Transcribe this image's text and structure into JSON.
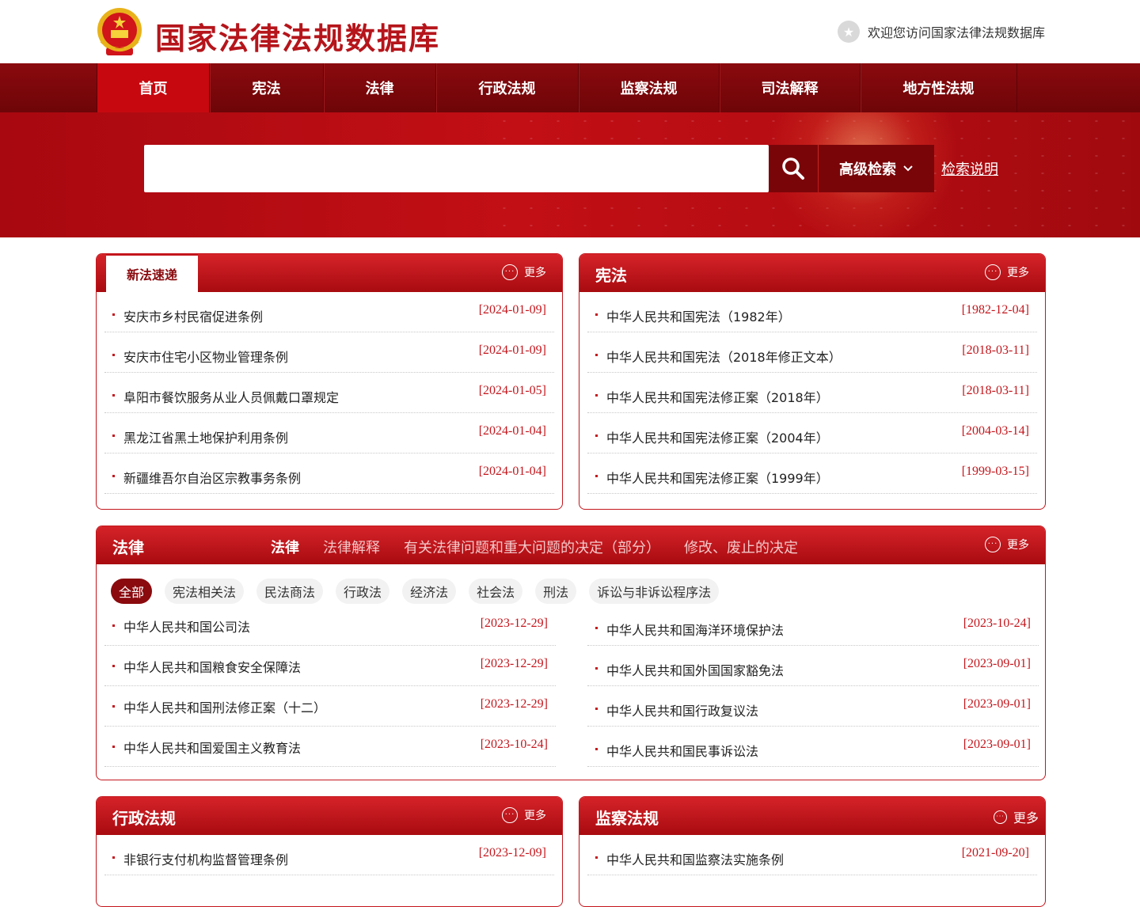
{
  "header": {
    "site_title": "国家法律法规数据库",
    "welcome": "欢迎您访问国家法律法规数据库"
  },
  "nav": {
    "items": [
      {
        "label": "首页",
        "active": true
      },
      {
        "label": "宪法"
      },
      {
        "label": "法律"
      },
      {
        "label": "行政法规"
      },
      {
        "label": "监察法规"
      },
      {
        "label": "司法解释"
      },
      {
        "label": "地方性法规"
      }
    ]
  },
  "search": {
    "placeholder": "",
    "advanced_label": "高级检索",
    "help_label": "检索说明"
  },
  "more_label": "更多",
  "new_laws": {
    "tab": "新法速递",
    "items": [
      {
        "title": "安庆市乡村民宿促进条例",
        "date": "[2024-01-09]"
      },
      {
        "title": "安庆市住宅小区物业管理条例",
        "date": "[2024-01-09]"
      },
      {
        "title": "阜阳市餐饮服务从业人员佩戴口罩规定",
        "date": "[2024-01-05]"
      },
      {
        "title": "黑龙江省黑土地保护利用条例",
        "date": "[2024-01-04]"
      },
      {
        "title": "新疆维吾尔自治区宗教事务条例",
        "date": "[2024-01-04]"
      }
    ]
  },
  "constitution": {
    "title": "宪法",
    "items": [
      {
        "title": "中华人民共和国宪法（1982年）",
        "date": "[1982-12-04]"
      },
      {
        "title": "中华人民共和国宪法（2018年修正文本）",
        "date": "[2018-03-11]"
      },
      {
        "title": "中华人民共和国宪法修正案（2018年）",
        "date": "[2018-03-11]"
      },
      {
        "title": "中华人民共和国宪法修正案（2004年）",
        "date": "[2004-03-14]"
      },
      {
        "title": "中华人民共和国宪法修正案（1999年）",
        "date": "[1999-03-15]"
      }
    ]
  },
  "law": {
    "title": "法律",
    "sub_tabs": [
      {
        "label": "法律",
        "active": true
      },
      {
        "label": "法律解释"
      },
      {
        "label": "有关法律问题和重大问题的决定（部分）"
      },
      {
        "label": "修改、废止的决定"
      }
    ],
    "chips": [
      {
        "label": "全部",
        "active": true
      },
      {
        "label": "宪法相关法"
      },
      {
        "label": "民法商法"
      },
      {
        "label": "行政法"
      },
      {
        "label": "经济法"
      },
      {
        "label": "社会法"
      },
      {
        "label": "刑法"
      },
      {
        "label": "诉讼与非诉讼程序法"
      }
    ],
    "left_items": [
      {
        "title": "中华人民共和国公司法",
        "date": "[2023-12-29]"
      },
      {
        "title": "中华人民共和国粮食安全保障法",
        "date": "[2023-12-29]"
      },
      {
        "title": "中华人民共和国刑法修正案（十二）",
        "date": "[2023-12-29]"
      },
      {
        "title": "中华人民共和国爱国主义教育法",
        "date": "[2023-10-24]"
      }
    ],
    "right_items": [
      {
        "title": "中华人民共和国海洋环境保护法",
        "date": "[2023-10-24]"
      },
      {
        "title": "中华人民共和国外国国家豁免法",
        "date": "[2023-09-01]"
      },
      {
        "title": "中华人民共和国行政复议法",
        "date": "[2023-09-01]"
      },
      {
        "title": "中华人民共和国民事诉讼法",
        "date": "[2023-09-01]"
      }
    ]
  },
  "admin_regs": {
    "title": "行政法规",
    "first_item": {
      "title": "非银行支付机构监督管理条例",
      "date": "[2023-12-09]"
    }
  },
  "supervision_regs": {
    "title": "监察法规",
    "first_item": {
      "title": "中华人民共和国监察法实施条例",
      "date": "[2021-09-20]"
    }
  },
  "colors": {
    "brand_red": "#c4161c",
    "nav_dark": "#7a0509",
    "date_red": "#c4161c"
  }
}
